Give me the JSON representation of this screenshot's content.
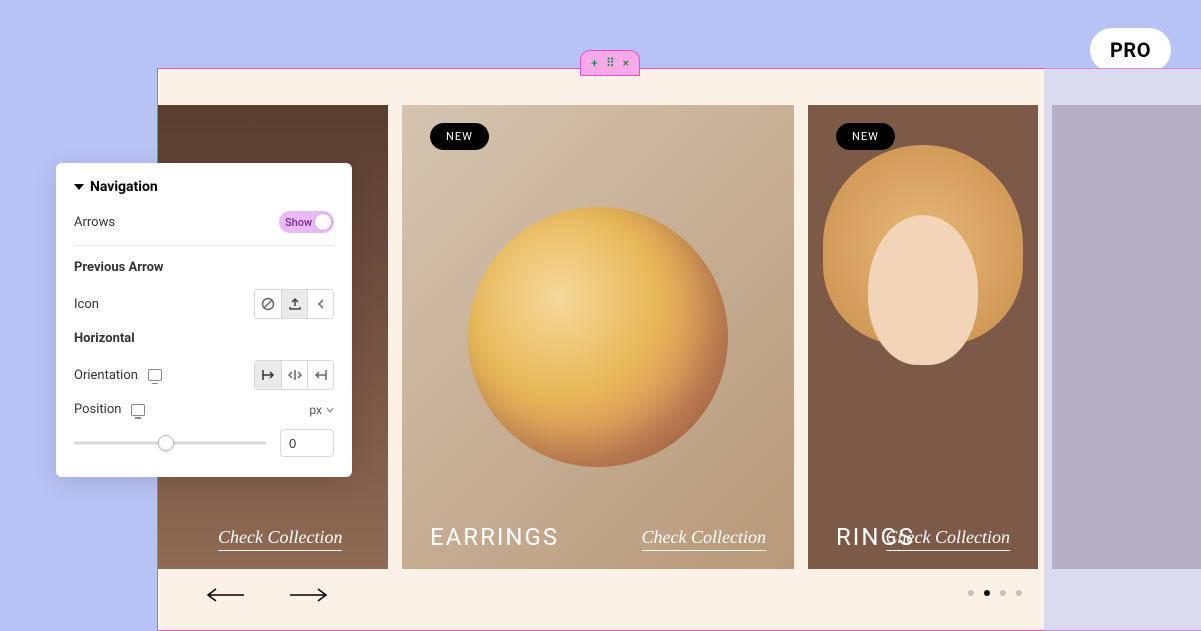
{
  "pro_badge": "PRO",
  "editor_handle": {
    "add": "+",
    "grip": "⠿",
    "close": "×"
  },
  "panel": {
    "title": "Navigation",
    "arrows_label": "Arrows",
    "toggle_text": "Show",
    "previous_arrow_label": "Previous Arrow",
    "icon_label": "Icon",
    "horizontal_label": "Horizontal",
    "orientation_label": "Orientation",
    "position_label": "Position",
    "position_unit": "px",
    "position_value": "0"
  },
  "slides": {
    "new_badge": "NEW",
    "check_link": "Check Collection",
    "items": [
      {
        "title": ""
      },
      {
        "title": "EARRINGS"
      },
      {
        "title": "RINGS"
      },
      {
        "title": ""
      }
    ]
  }
}
